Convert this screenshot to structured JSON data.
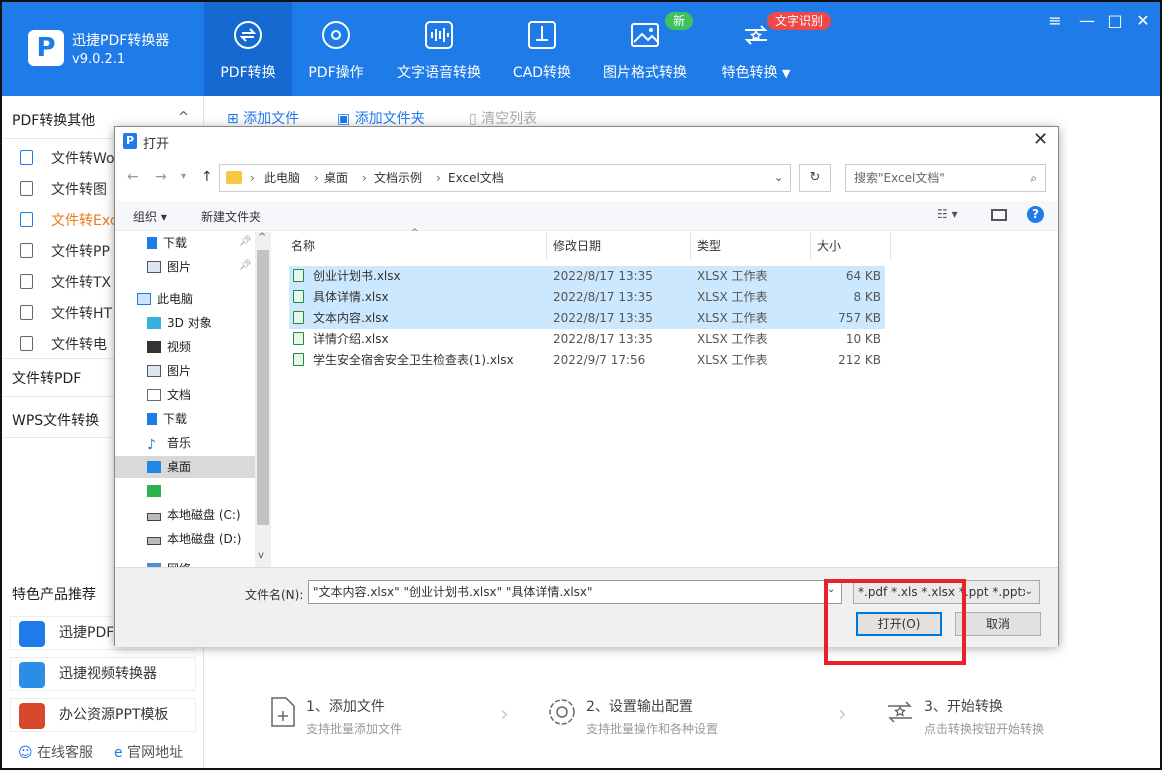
{
  "app": {
    "name": "迅捷PDF转换器",
    "version": "v9.0.2.1",
    "logo": "P"
  },
  "nav": [
    {
      "label": "PDF转换",
      "icon": "pdf-convert-icon",
      "active": true
    },
    {
      "label": "PDF操作",
      "icon": "gear-icon"
    },
    {
      "label": "文字语音转换",
      "icon": "audio-wave-icon"
    },
    {
      "label": "CAD转换",
      "icon": "cad-icon"
    },
    {
      "label": "图片格式转换",
      "icon": "image-icon"
    },
    {
      "label": "特色转换",
      "icon": "star-convert-icon"
    }
  ],
  "badges": {
    "new": "新",
    "ocr": "文字识别"
  },
  "window": {
    "menu": "≡",
    "minimize": "—",
    "maximize": "□",
    "close": "✕"
  },
  "sidebar": {
    "section1": "PDF转换其他",
    "section1_chevron": "^",
    "items": [
      "文件转Wo",
      "文件转图",
      "文件转Exc",
      "文件转PP",
      "文件转TX",
      "文件转HT",
      "文件转电"
    ],
    "item_icons": [
      "W",
      "▨",
      "E",
      "P",
      "T",
      "H",
      "e"
    ],
    "section2": "文件转PDF",
    "section3": "WPS文件转换",
    "promo_title": "特色产品推荐",
    "promos": [
      "迅捷PDF",
      "迅捷视频转换器",
      "办公资源PPT模板"
    ],
    "footer": {
      "service": "在线客服",
      "website": "官网地址"
    }
  },
  "toolbar": {
    "add_file": "添加文件",
    "add_folder": "添加文件夹",
    "clear": "清空列表"
  },
  "steps": [
    {
      "title": "1、添加文件",
      "sub": "支持批量添加文件"
    },
    {
      "title": "2、设置输出配置",
      "sub": "支持批量操作和各种设置"
    },
    {
      "title": "3、开始转换",
      "sub": "点击转换按钮开始转换"
    }
  ],
  "dialog": {
    "title": "打开",
    "breadcrumb": [
      "此电脑",
      "桌面",
      "文档示例",
      "Excel文档"
    ],
    "search_placeholder": "搜索\"Excel文档\"",
    "organize": "组织",
    "new_folder": "新建文件夹",
    "tree": [
      {
        "label": "下载",
        "pinned": true
      },
      {
        "label": "图片",
        "pinned": true
      },
      {
        "label": "此电脑"
      },
      {
        "label": "3D 对象"
      },
      {
        "label": "视频"
      },
      {
        "label": "图片"
      },
      {
        "label": "文档"
      },
      {
        "label": "下载"
      },
      {
        "label": "音乐"
      },
      {
        "label": "桌面",
        "selected": true
      },
      {
        "label": ""
      },
      {
        "label": "本地磁盘 (C:)"
      },
      {
        "label": "本地磁盘 (D:)"
      },
      {
        "label": "网络"
      }
    ],
    "columns": {
      "name": "名称",
      "date": "修改日期",
      "type": "类型",
      "size": "大小"
    },
    "files": [
      {
        "name": "创业计划书.xlsx",
        "date": "2022/8/17 13:35",
        "type": "XLSX 工作表",
        "size": "64 KB",
        "selected": true
      },
      {
        "name": "具体详情.xlsx",
        "date": "2022/8/17 13:35",
        "type": "XLSX 工作表",
        "size": "8 KB",
        "selected": true
      },
      {
        "name": "文本内容.xlsx",
        "date": "2022/8/17 13:35",
        "type": "XLSX 工作表",
        "size": "757 KB",
        "selected": true
      },
      {
        "name": "详情介绍.xlsx",
        "date": "2022/8/17 13:35",
        "type": "XLSX 工作表",
        "size": "10 KB",
        "selected": false
      },
      {
        "name": "学生安全宿舍安全卫生检查表(1).xlsx",
        "date": "2022/9/7 17:56",
        "type": "XLSX 工作表",
        "size": "212 KB",
        "selected": false
      }
    ],
    "filename_label": "文件名(N):",
    "filename_value": "\"文本内容.xlsx\" \"创业计划书.xlsx\" \"具体详情.xlsx\"",
    "filetype": "*.pdf *.xls *.xlsx *.ppt *.pptx",
    "open_button": "打开(O)",
    "cancel_button": "取消"
  },
  "colors": {
    "brand": "#1e7be8",
    "selection": "#cce8ff",
    "highlight": "#e8222d",
    "accent_orange": "#e97b18"
  }
}
